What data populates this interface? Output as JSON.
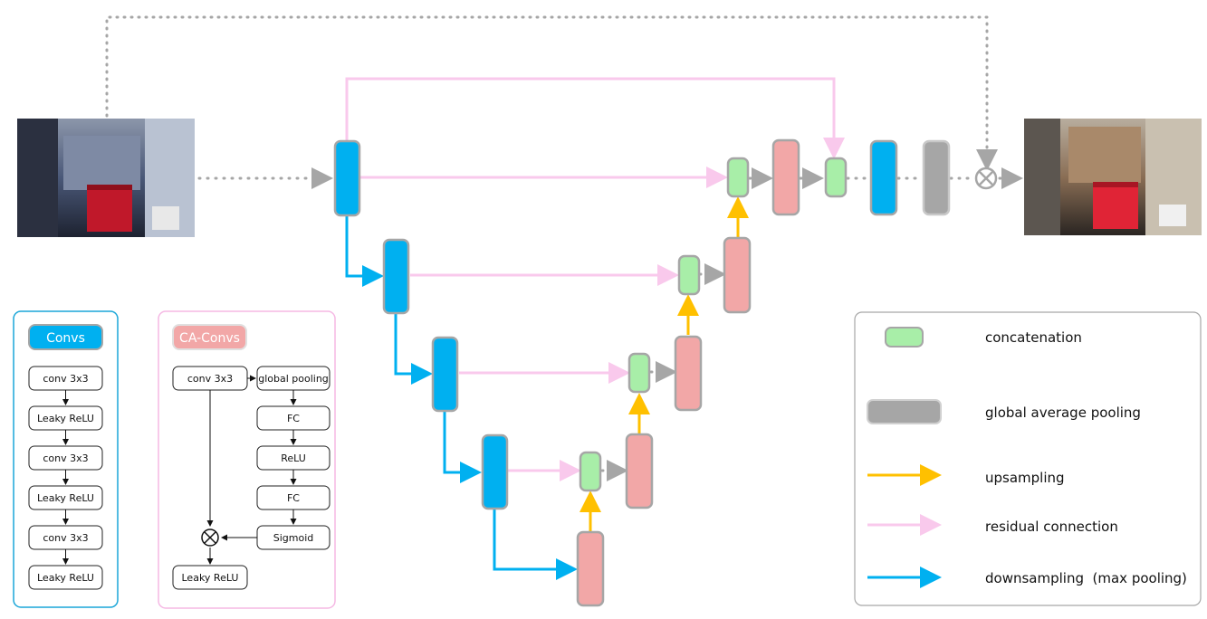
{
  "colors": {
    "conv_block": "#00b0f0",
    "ca_block": "#f2a7a7",
    "concat_block": "#a8eea8",
    "pool_block": "#a6a6a6",
    "upsampling": "#ffc000",
    "residual": "#f9c9ec",
    "downsampling": "#00b0f0",
    "skip_dotted": "#a6a6a6"
  },
  "convs_box": {
    "title": "Convs",
    "layers": [
      "conv 3x3",
      "Leaky ReLU",
      "conv 3x3",
      "Leaky ReLU",
      "conv 3x3",
      "Leaky ReLU"
    ]
  },
  "ca_convs_box": {
    "title": "CA-Convs",
    "left_top": "conv 3x3",
    "right_column": [
      "global pooling",
      "FC",
      "ReLU",
      "FC",
      "Sigmoid"
    ],
    "bottom": "Leaky ReLU"
  },
  "legend": {
    "concatenation": "concatenation",
    "global_average_pooling": "global average pooling",
    "upsampling": "upsampling",
    "residual_connection": "residual connection",
    "downsampling": "downsampling  (max pooling)"
  },
  "images": {
    "input": "low-light-input-photo",
    "output": "enhanced-output-photo"
  }
}
